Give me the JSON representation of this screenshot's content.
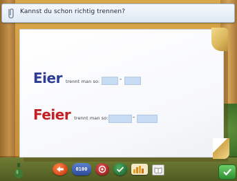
{
  "window": {
    "title": "Kannst du schon richtig trennen?"
  },
  "exercise": {
    "rows": [
      {
        "word": "Eier",
        "phrase": "trennt man so:",
        "separator": "-",
        "word_color": "#2f3c93"
      },
      {
        "word": "Feier",
        "phrase": "trennt man so:",
        "separator": "-",
        "word_color": "#c41f22"
      }
    ],
    "blank_color": "#c7dcf3"
  },
  "toolbar": {
    "counter_text": "0100",
    "icons": [
      "back-arrow-icon",
      "counter-display-icon",
      "help-icon",
      "check-icon",
      "statistics-icon",
      "book-icon"
    ]
  },
  "accent_colors": {
    "paper": "#ffffff",
    "title_bar": "#e9f0f7",
    "ok_button": "#3fa440"
  }
}
